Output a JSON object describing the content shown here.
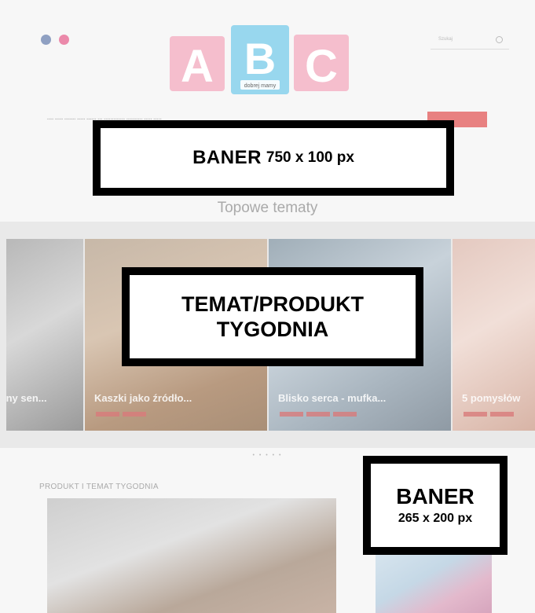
{
  "header": {
    "social_icons": [
      "facebook-icon",
      "instagram-icon"
    ],
    "logo": {
      "letters": [
        "A",
        "B",
        "C"
      ],
      "tagline": "dobrej mamy"
    },
    "search": {
      "placeholder": "Szukaj"
    }
  },
  "banners": {
    "top": {
      "title": "BANER",
      "size": "750 x 100 px"
    },
    "carousel_overlay": {
      "line1": "TEMAT/PRODUKT",
      "line2": "TYGODNIA"
    },
    "side": {
      "title": "BANER",
      "size": "265 x 200 px"
    }
  },
  "section": {
    "topowe_title": "Topowe tematy",
    "product_title": "PRODUKT I TEMAT TYGODNIA"
  },
  "carousel": {
    "slides": [
      {
        "caption": "jny sen..."
      },
      {
        "caption": "Kaszki jako źródło..."
      },
      {
        "caption": "Blisko serca - mufka..."
      },
      {
        "caption": "5 pomysłów"
      }
    ],
    "dots": "• • • • •"
  },
  "colors": {
    "logo_pink": "#f4b4c6",
    "logo_blue": "#8dd3ec",
    "accent": "#e57373"
  }
}
